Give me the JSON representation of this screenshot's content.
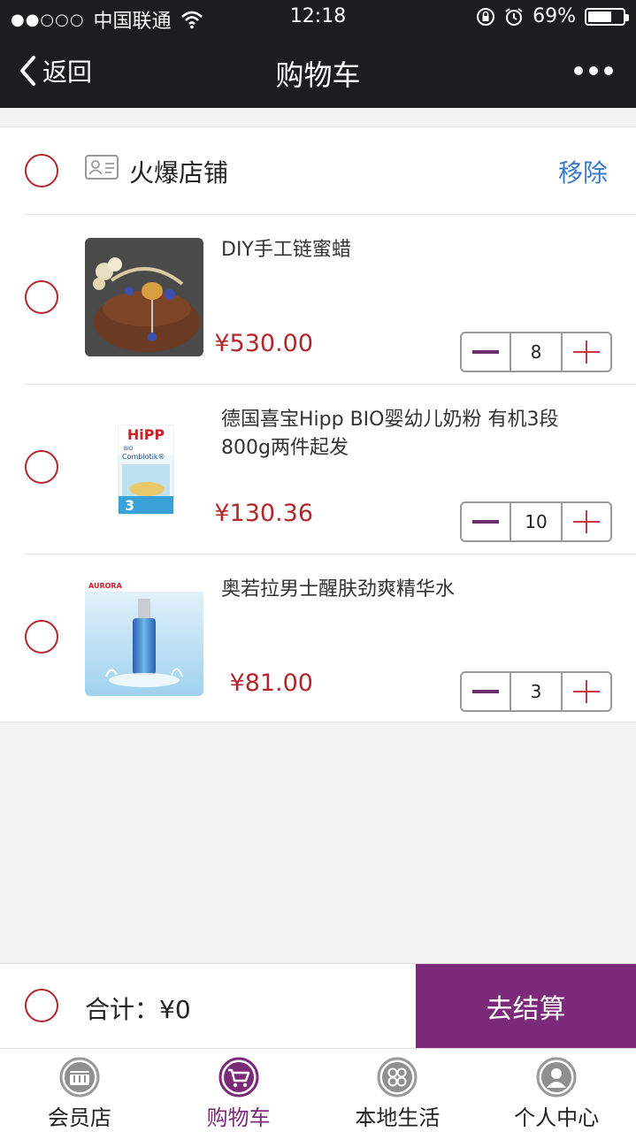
{
  "status_bar": {
    "signal": "●●○○○",
    "carrier": "中国联通",
    "time": "12:18",
    "battery_percent": "69%",
    "battery_level": 0.69
  },
  "nav": {
    "back_label": "返回",
    "title": "购物车"
  },
  "shop": {
    "name": "火爆店铺",
    "remove_label": "移除"
  },
  "items": [
    {
      "name": "DIY手工链蜜蜡",
      "price": "¥530.00",
      "quantity": "8"
    },
    {
      "name": "德国喜宝Hipp BIO婴幼儿奶粉 有机3段 800g两件起发",
      "price": "¥130.36",
      "quantity": "10",
      "image_text_1": "HiPP",
      "image_text_2": "BIO",
      "image_text_3": "Combiotik®",
      "image_text_4": "3"
    },
    {
      "name": "奥若拉男士醒肤劲爽精华水",
      "price": "¥81.00",
      "quantity": "3",
      "image_text_1": "AURORA"
    }
  ],
  "footer": {
    "total_label": "合计：",
    "total_value": "¥0",
    "checkout_label": "去结算"
  },
  "tabs": [
    {
      "label": "会员店"
    },
    {
      "label": "购物车"
    },
    {
      "label": "本地生活"
    },
    {
      "label": "个人中心"
    }
  ],
  "colors": {
    "header_bg": "#1d1d1f",
    "accent_purple": "#7b2a7a",
    "price_red": "#b3262b",
    "link_blue": "#3a79c7"
  }
}
